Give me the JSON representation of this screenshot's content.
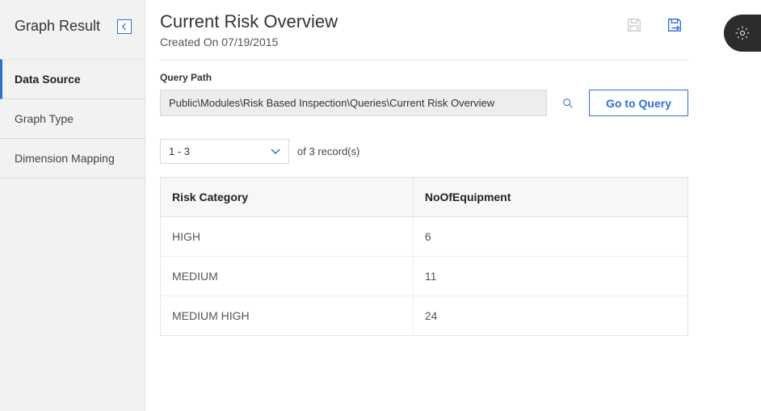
{
  "sidebar": {
    "title": "Graph Result",
    "items": [
      {
        "label": "Data Source",
        "active": true
      },
      {
        "label": "Graph Type",
        "active": false
      },
      {
        "label": "Dimension Mapping",
        "active": false
      }
    ]
  },
  "header": {
    "title": "Current Risk Overview",
    "created_on": "Created On 07/19/2015"
  },
  "query": {
    "label": "Query Path",
    "value": "Public\\Modules\\Risk Based Inspection\\Queries\\Current Risk Overview",
    "go_label": "Go to Query"
  },
  "records": {
    "range": "1 - 3",
    "of_label": "of",
    "count": "3",
    "records_label": "record(s)"
  },
  "table": {
    "columns": [
      "Risk Category",
      "NoOfEquipment"
    ],
    "rows": [
      {
        "category": "HIGH",
        "count": "6"
      },
      {
        "category": "MEDIUM",
        "count": "11"
      },
      {
        "category": "MEDIUM HIGH",
        "count": "24"
      }
    ]
  }
}
